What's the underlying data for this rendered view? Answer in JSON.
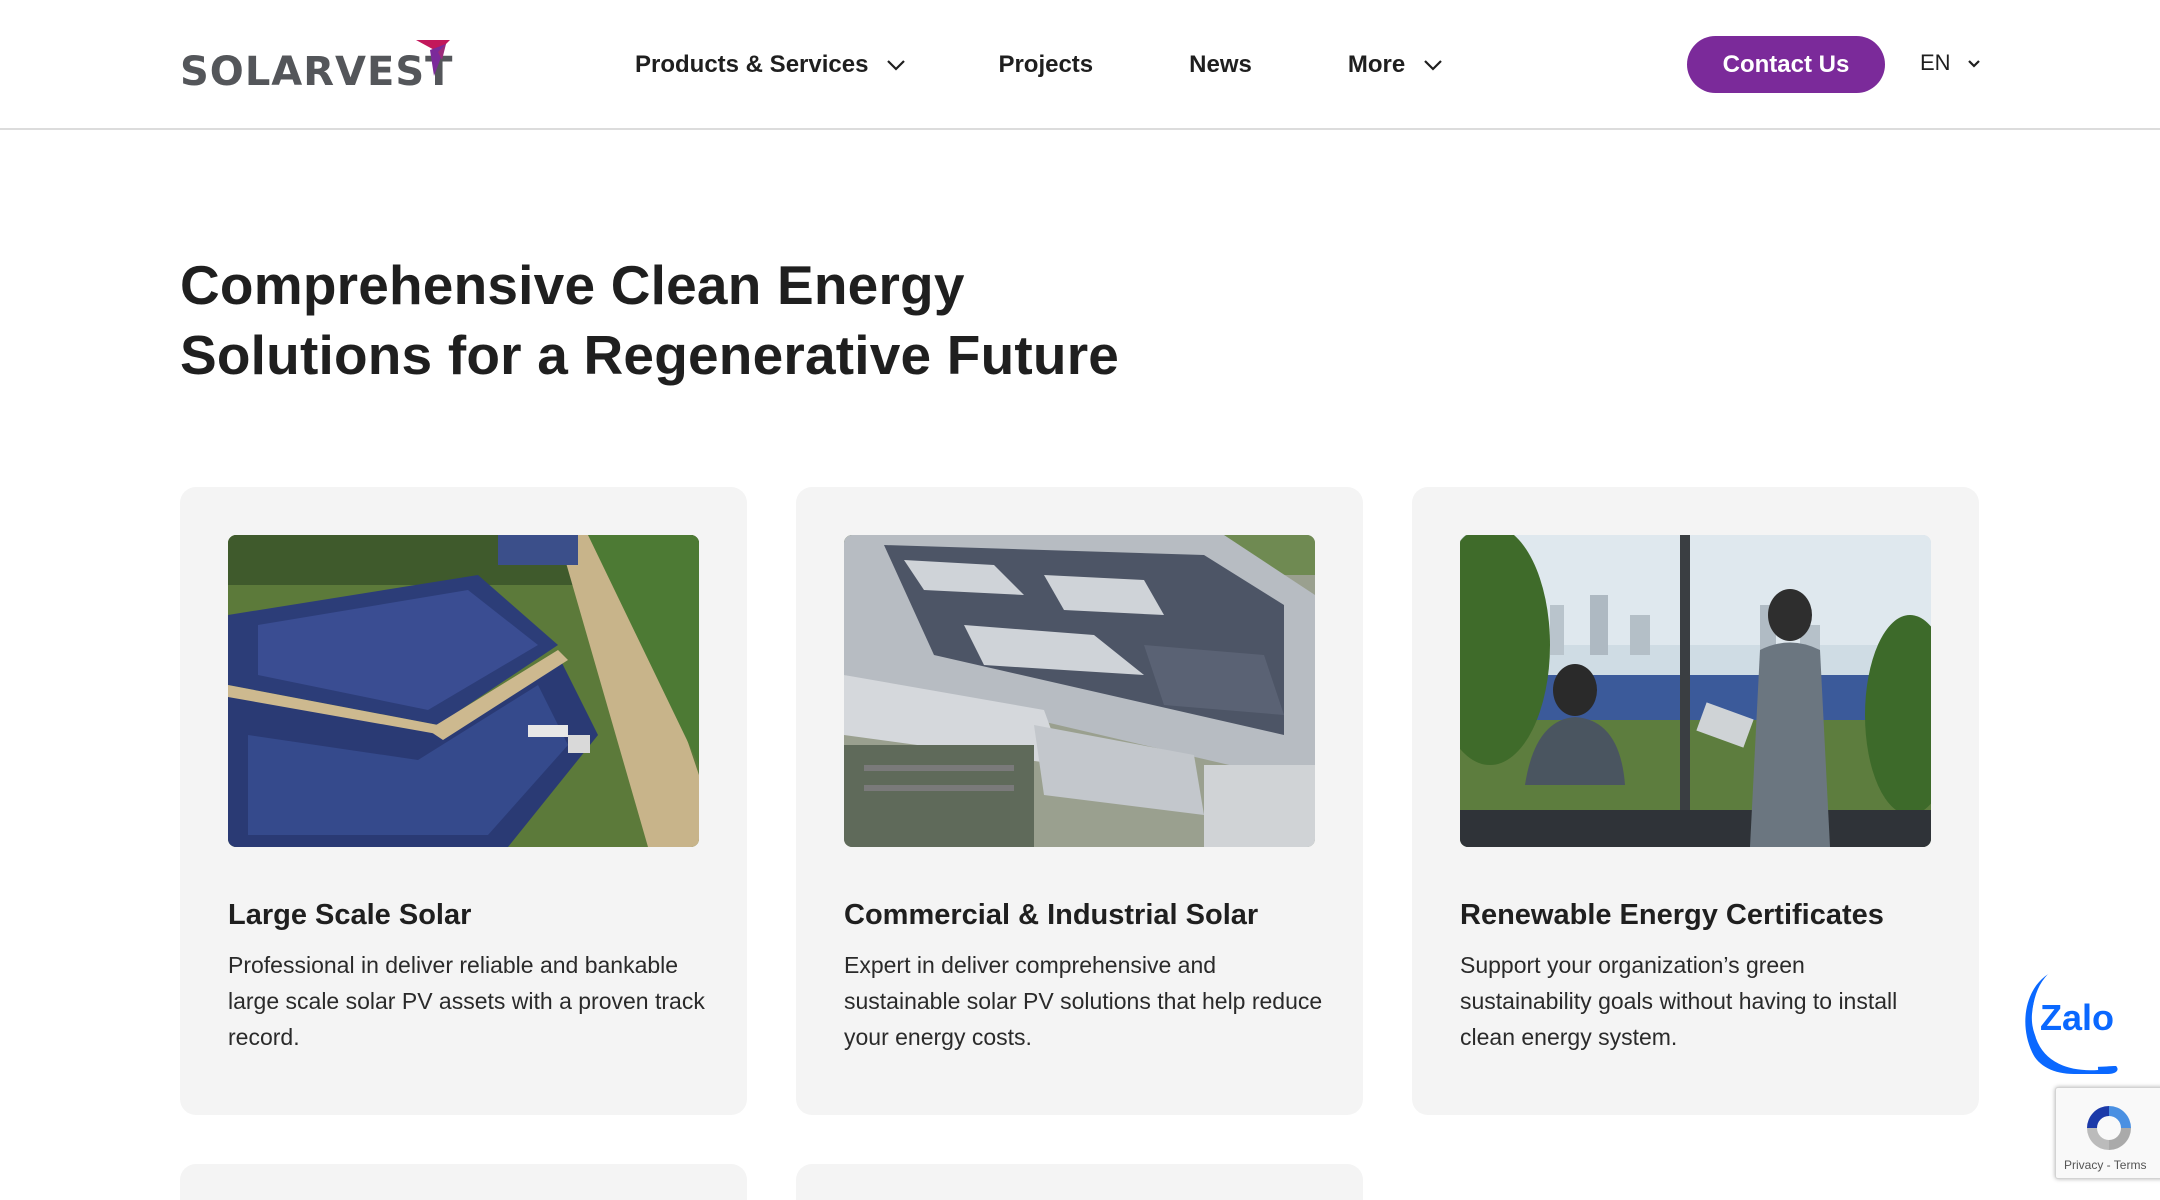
{
  "brand": {
    "name": "SOLARVEST",
    "accent_color": "#7b2a9a",
    "logo_mark_colors": [
      "#c2185b",
      "#7b2a9a"
    ]
  },
  "nav": {
    "items": [
      {
        "label": "Products & Services",
        "has_dropdown": true
      },
      {
        "label": "Projects",
        "has_dropdown": false
      },
      {
        "label": "News",
        "has_dropdown": false
      },
      {
        "label": "More",
        "has_dropdown": true
      }
    ],
    "contact_label": "Contact Us",
    "language": "EN"
  },
  "hero": {
    "heading_line1": "Comprehensive Clean Energy",
    "heading_line2": "Solutions for a Regenerative Future"
  },
  "cards": [
    {
      "title": "Large Scale Solar",
      "description": "Professional in deliver reliable and bankable large scale solar PV assets with a proven track record.",
      "image": "aerial-solar-farm-image"
    },
    {
      "title": "Commercial & Industrial Solar",
      "description": "Expert in deliver comprehensive and sustainable solar PV solutions that help reduce your energy costs.",
      "image": "rooftop-solar-factory-image"
    },
    {
      "title": "Renewable Energy Certificates",
      "description": "Support your organization’s green sustainability goals without having to install clean energy system.",
      "image": "office-meeting-image"
    }
  ],
  "widgets": {
    "zalo_label": "Zalo",
    "recaptcha_links": "Privacy - Terms"
  }
}
